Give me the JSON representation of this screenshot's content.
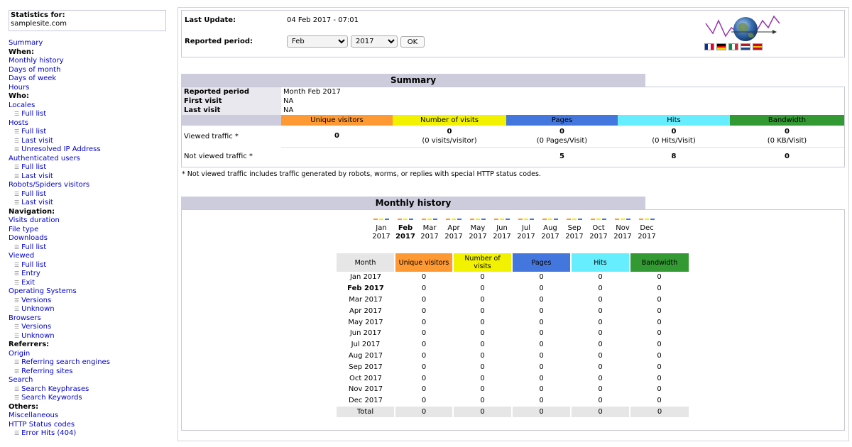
{
  "sidebar": {
    "stats_title": "Statistics for:",
    "site": "samplesite.com",
    "items": [
      {
        "label": "Summary",
        "type": "link",
        "name": "summary"
      },
      {
        "label": "When:",
        "type": "head",
        "name": "when"
      },
      {
        "label": "Monthly history",
        "type": "link",
        "name": "monthly-history"
      },
      {
        "label": "Days of month",
        "type": "link",
        "name": "days-of-month"
      },
      {
        "label": "Days of week",
        "type": "link",
        "name": "days-of-week"
      },
      {
        "label": "Hours",
        "type": "link",
        "name": "hours"
      },
      {
        "label": "Who:",
        "type": "head",
        "name": "who"
      },
      {
        "label": "Locales",
        "type": "link",
        "name": "locales"
      },
      {
        "label": "Full list",
        "type": "sub",
        "name": "locales-full-list"
      },
      {
        "label": "Hosts",
        "type": "link",
        "name": "hosts"
      },
      {
        "label": "Full list",
        "type": "sub",
        "name": "hosts-full-list"
      },
      {
        "label": "Last visit",
        "type": "sub",
        "name": "hosts-last-visit"
      },
      {
        "label": "Unresolved IP Address",
        "type": "sub",
        "name": "unresolved-ip"
      },
      {
        "label": "Authenticated users",
        "type": "link",
        "name": "authenticated-users"
      },
      {
        "label": "Full list",
        "type": "sub",
        "name": "auth-full-list"
      },
      {
        "label": "Last visit",
        "type": "sub",
        "name": "auth-last-visit"
      },
      {
        "label": "Robots/Spiders visitors",
        "type": "link",
        "name": "robots-spiders"
      },
      {
        "label": "Full list",
        "type": "sub",
        "name": "robots-full-list"
      },
      {
        "label": "Last visit",
        "type": "sub",
        "name": "robots-last-visit"
      },
      {
        "label": "Navigation:",
        "type": "head",
        "name": "navigation"
      },
      {
        "label": "Visits duration",
        "type": "link",
        "name": "visits-duration"
      },
      {
        "label": "File type",
        "type": "link",
        "name": "file-type"
      },
      {
        "label": "Downloads",
        "type": "link",
        "name": "downloads"
      },
      {
        "label": "Full list",
        "type": "sub",
        "name": "downloads-full-list"
      },
      {
        "label": "Viewed",
        "type": "link",
        "name": "viewed"
      },
      {
        "label": "Full list",
        "type": "sub",
        "name": "viewed-full-list"
      },
      {
        "label": "Entry",
        "type": "sub",
        "name": "viewed-entry"
      },
      {
        "label": "Exit",
        "type": "sub",
        "name": "viewed-exit"
      },
      {
        "label": "Operating Systems",
        "type": "link",
        "name": "operating-systems"
      },
      {
        "label": "Versions",
        "type": "sub",
        "name": "os-versions"
      },
      {
        "label": "Unknown",
        "type": "sub",
        "name": "os-unknown"
      },
      {
        "label": "Browsers",
        "type": "link",
        "name": "browsers"
      },
      {
        "label": "Versions",
        "type": "sub",
        "name": "browsers-versions"
      },
      {
        "label": "Unknown",
        "type": "sub",
        "name": "browsers-unknown"
      },
      {
        "label": "Referrers:",
        "type": "head",
        "name": "referrers"
      },
      {
        "label": "Origin",
        "type": "link",
        "name": "origin"
      },
      {
        "label": "Referring search engines",
        "type": "sub",
        "name": "referring-search-engines"
      },
      {
        "label": "Referring sites",
        "type": "sub",
        "name": "referring-sites"
      },
      {
        "label": "Search",
        "type": "link",
        "name": "search"
      },
      {
        "label": "Search Keyphrases",
        "type": "sub",
        "name": "search-keyphrases"
      },
      {
        "label": "Search Keywords",
        "type": "sub",
        "name": "search-keywords"
      },
      {
        "label": "Others:",
        "type": "head",
        "name": "others"
      },
      {
        "label": "Miscellaneous",
        "type": "link",
        "name": "miscellaneous"
      },
      {
        "label": "HTTP Status codes",
        "type": "link",
        "name": "http-status-codes"
      },
      {
        "label": "Error Hits (404)",
        "type": "sub",
        "name": "error-hits-404"
      }
    ]
  },
  "header": {
    "last_update_label": "Last Update:",
    "last_update_value": "04 Feb 2017 - 07:01",
    "period_label": "Reported period:",
    "month_selected": "Feb",
    "year_selected": "2017",
    "ok_label": "OK",
    "flags": [
      {
        "name": "french-flag",
        "colors": [
          "#0032a0",
          "#ffffff",
          "#e4002b"
        ]
      },
      {
        "name": "german-flag",
        "colors": [
          "#000000",
          "#dd0000",
          "#ffce00"
        ],
        "horizontal": true
      },
      {
        "name": "italian-flag",
        "colors": [
          "#009246",
          "#ffffff",
          "#ce2b37"
        ]
      },
      {
        "name": "dutch-flag",
        "colors": [
          "#ae1c28",
          "#ffffff",
          "#21468b"
        ],
        "horizontal": true
      },
      {
        "name": "spanish-flag",
        "colors": [
          "#c60b1e",
          "#ffc400",
          "#c60b1e"
        ],
        "horizontal": true
      }
    ]
  },
  "colors": {
    "unique_visitors": "#ff9933",
    "visits": "#f2f200",
    "pages": "#4477dd",
    "hits": "#66eeff",
    "bandwidth": "#339933",
    "title_bar": "#ccccdd"
  },
  "summary": {
    "title": "Summary",
    "reported_period_label": "Reported period",
    "reported_period_value": "Month Feb 2017",
    "first_visit_label": "First visit",
    "first_visit_value": "NA",
    "last_visit_label": "Last visit",
    "last_visit_value": "NA",
    "columns": [
      "Unique visitors",
      "Number of visits",
      "Pages",
      "Hits",
      "Bandwidth"
    ],
    "viewed_label": "Viewed traffic *",
    "viewed": [
      {
        "value": "0",
        "sub": ""
      },
      {
        "value": "0",
        "sub": "(0 visits/visitor)"
      },
      {
        "value": "0",
        "sub": "(0 Pages/Visit)"
      },
      {
        "value": "0",
        "sub": "(0 Hits/Visit)"
      },
      {
        "value": "0",
        "sub": "(0 KB/Visit)"
      }
    ],
    "not_viewed_label": "Not viewed traffic *",
    "not_viewed": [
      "",
      "",
      "5",
      "8",
      "0"
    ],
    "note": "* Not viewed traffic includes traffic generated by robots, worms, or replies with special HTTP status codes."
  },
  "monthly": {
    "title": "Monthly history",
    "chart_months": [
      {
        "m": "Jan",
        "y": "2017",
        "bold": false
      },
      {
        "m": "Feb",
        "y": "2017",
        "bold": true
      },
      {
        "m": "Mar",
        "y": "2017",
        "bold": false
      },
      {
        "m": "Apr",
        "y": "2017",
        "bold": false
      },
      {
        "m": "May",
        "y": "2017",
        "bold": false
      },
      {
        "m": "Jun",
        "y": "2017",
        "bold": false
      },
      {
        "m": "Jul",
        "y": "2017",
        "bold": false
      },
      {
        "m": "Aug",
        "y": "2017",
        "bold": false
      },
      {
        "m": "Sep",
        "y": "2017",
        "bold": false
      },
      {
        "m": "Oct",
        "y": "2017",
        "bold": false
      },
      {
        "m": "Nov",
        "y": "2017",
        "bold": false
      },
      {
        "m": "Dec",
        "y": "2017",
        "bold": false
      }
    ],
    "headers": [
      "Month",
      "Unique visitors",
      "Number of visits",
      "Pages",
      "Hits",
      "Bandwidth"
    ],
    "rows": [
      {
        "month": "Jan 2017",
        "bold": false,
        "vals": [
          "0",
          "0",
          "0",
          "0",
          "0"
        ]
      },
      {
        "month": "Feb 2017",
        "bold": true,
        "vals": [
          "0",
          "0",
          "0",
          "0",
          "0"
        ]
      },
      {
        "month": "Mar 2017",
        "bold": false,
        "vals": [
          "0",
          "0",
          "0",
          "0",
          "0"
        ]
      },
      {
        "month": "Apr 2017",
        "bold": false,
        "vals": [
          "0",
          "0",
          "0",
          "0",
          "0"
        ]
      },
      {
        "month": "May 2017",
        "bold": false,
        "vals": [
          "0",
          "0",
          "0",
          "0",
          "0"
        ]
      },
      {
        "month": "Jun 2017",
        "bold": false,
        "vals": [
          "0",
          "0",
          "0",
          "0",
          "0"
        ]
      },
      {
        "month": "Jul 2017",
        "bold": false,
        "vals": [
          "0",
          "0",
          "0",
          "0",
          "0"
        ]
      },
      {
        "month": "Aug 2017",
        "bold": false,
        "vals": [
          "0",
          "0",
          "0",
          "0",
          "0"
        ]
      },
      {
        "month": "Sep 2017",
        "bold": false,
        "vals": [
          "0",
          "0",
          "0",
          "0",
          "0"
        ]
      },
      {
        "month": "Oct 2017",
        "bold": false,
        "vals": [
          "0",
          "0",
          "0",
          "0",
          "0"
        ]
      },
      {
        "month": "Nov 2017",
        "bold": false,
        "vals": [
          "0",
          "0",
          "0",
          "0",
          "0"
        ]
      },
      {
        "month": "Dec 2017",
        "bold": false,
        "vals": [
          "0",
          "0",
          "0",
          "0",
          "0"
        ]
      }
    ],
    "total": {
      "label": "Total",
      "vals": [
        "0",
        "0",
        "0",
        "0",
        "0"
      ]
    }
  }
}
